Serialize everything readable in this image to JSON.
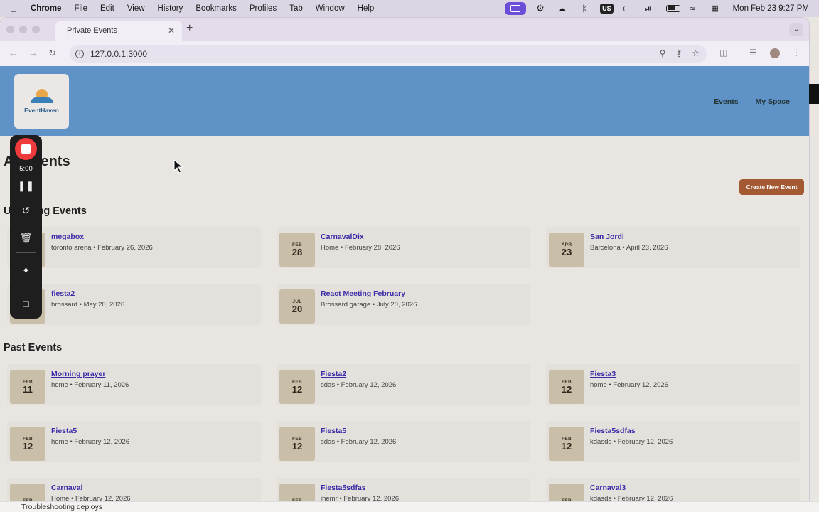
{
  "menubar": {
    "app": "Chrome",
    "items": [
      "File",
      "Edit",
      "View",
      "History",
      "Bookmarks",
      "Profiles",
      "Tab",
      "Window",
      "Help"
    ],
    "keyboard": "US",
    "datetime": "Mon Feb 23  9:27 PM"
  },
  "browser": {
    "tab_title": "Private Events",
    "url": "127.0.0.1:3000"
  },
  "site": {
    "logo_text": "EventHaven",
    "nav": [
      "Events",
      "My Space"
    ],
    "page_title_visible": "ents",
    "page_title_partial": "A",
    "create_button": "Create New Event",
    "upcoming_title_visible": "ng Events",
    "upcoming_title_partial": "U",
    "past_title": "Past Events"
  },
  "upcoming_events": [
    {
      "month": "",
      "day": "",
      "name": "megabox",
      "meta": "toronto arena • February 26, 2026"
    },
    {
      "month": "FEB",
      "day": "28",
      "name": "CarnavalDix",
      "meta": "Home • February 28, 2026"
    },
    {
      "month": "APR",
      "day": "23",
      "name": "San Jordi",
      "meta": "Barcelona • April 23, 2026"
    },
    {
      "month": "",
      "day": "",
      "name": "fiesta2",
      "meta": "brossard • May 20, 2026"
    },
    {
      "month": "JUL",
      "day": "20",
      "name": "React Meeting February",
      "meta": "Brossard garage • July 20, 2026"
    }
  ],
  "past_events": [
    {
      "month": "FEB",
      "day": "11",
      "name": "Morning prayer",
      "meta": "home • February 11, 2026"
    },
    {
      "month": "FEB",
      "day": "12",
      "name": "Fiesta2",
      "meta": "sdas • February 12, 2026"
    },
    {
      "month": "FEB",
      "day": "12",
      "name": "Fiesta3",
      "meta": "home • February 12, 2026"
    },
    {
      "month": "FEB",
      "day": "12",
      "name": "Fiesta5",
      "meta": "home • February 12, 2026"
    },
    {
      "month": "FEB",
      "day": "12",
      "name": "Fiesta5",
      "meta": "sdas • February 12, 2026"
    },
    {
      "month": "FEB",
      "day": "12",
      "name": "Fiesta5sdfas",
      "meta": "kdasds • February 12, 2026"
    },
    {
      "month": "FEB",
      "day": "",
      "name": "Carnaval",
      "meta": "Home • February 12, 2026"
    },
    {
      "month": "FEB",
      "day": "",
      "name": "Fiesta5sdfas",
      "meta": "jhemr • February 12, 2026"
    },
    {
      "month": "FEB",
      "day": "",
      "name": "Carnaval3",
      "meta": "kdasds • February 12, 2026"
    }
  ],
  "recorder": {
    "time": "5:00"
  },
  "bottom_bar": {
    "text": "Troubleshooting deploys"
  }
}
